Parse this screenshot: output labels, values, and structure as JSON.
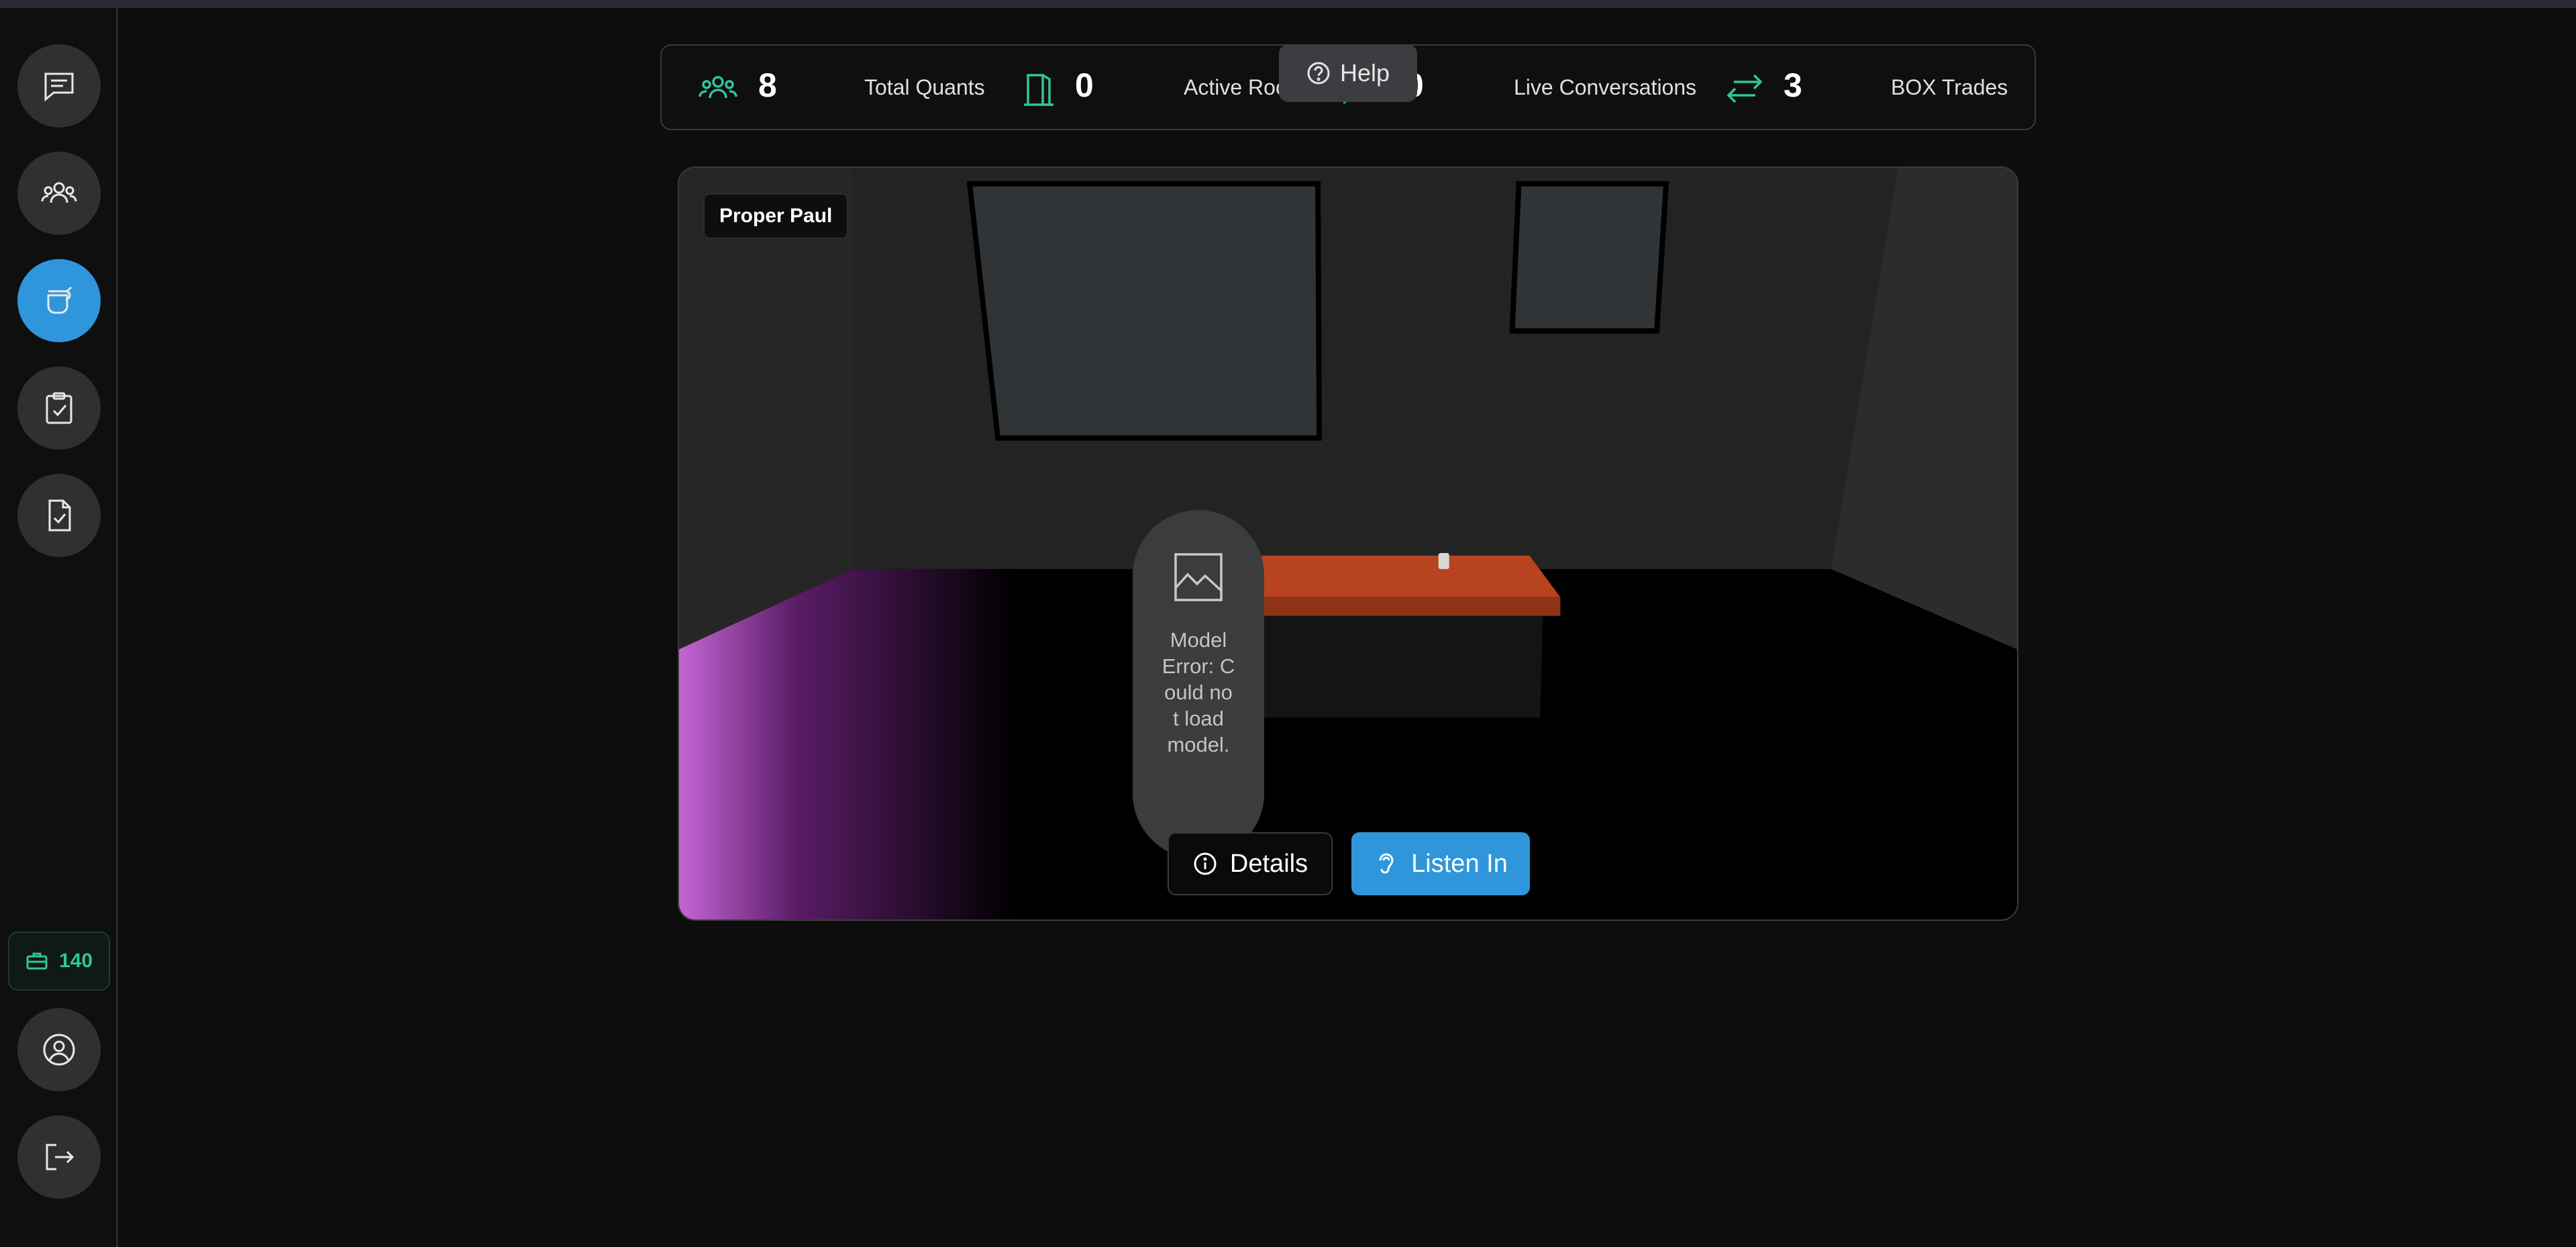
{
  "sidebar": {
    "items": [
      {
        "name": "chat",
        "icon": "chat-icon",
        "active": false
      },
      {
        "name": "community",
        "icon": "group-icon",
        "active": false
      },
      {
        "name": "rooms",
        "icon": "cup-icon",
        "active": true
      },
      {
        "name": "tasks",
        "icon": "clipboard-check-icon",
        "active": false
      },
      {
        "name": "documents",
        "icon": "document-check-icon",
        "active": false
      }
    ],
    "credits": {
      "icon": "briefcase-icon",
      "value": "140"
    },
    "profile_icon": "user-circle-icon",
    "logout_icon": "logout-icon"
  },
  "stats": [
    {
      "icon": "group-icon",
      "value": "8",
      "label": "Total Quants"
    },
    {
      "icon": "door-icon",
      "value": "0",
      "label": "Active Rooms"
    },
    {
      "icon": "chat-icon",
      "value": "0",
      "label": "Live Conversations"
    },
    {
      "icon": "swap-arrows-icon",
      "value": "3",
      "label": "BOX Trades"
    }
  ],
  "help": {
    "label": "Help",
    "icon": "question-circle-icon"
  },
  "room": {
    "name": "Proper Paul",
    "model_error": "Model Error: Could not load model.",
    "details_label": "Details",
    "listen_label": "Listen In"
  },
  "colors": {
    "accent": "#2fc59a",
    "primary": "#2f96dc",
    "background": "#0d0d0d"
  }
}
